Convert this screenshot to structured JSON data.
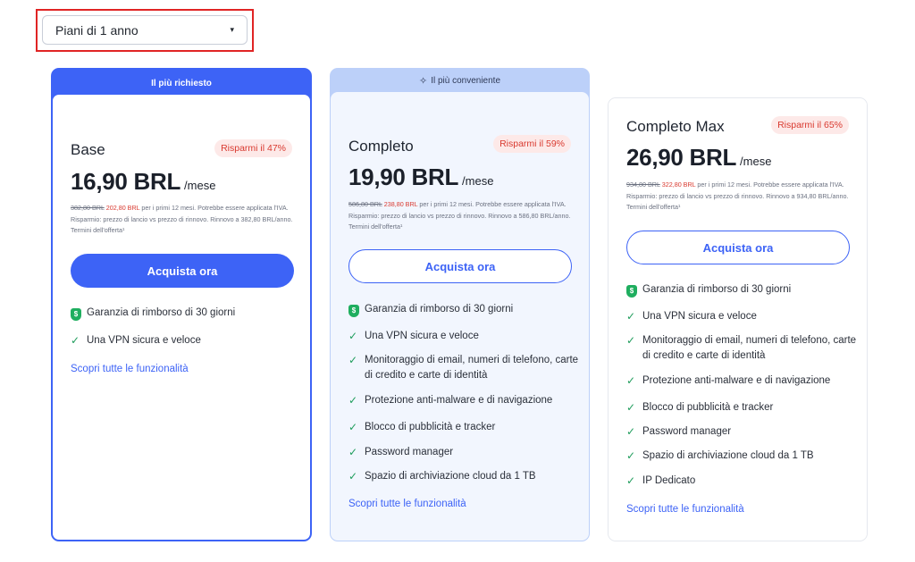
{
  "dropdown": {
    "label": "Piani di 1 anno",
    "caret": "▾"
  },
  "plans": [
    {
      "header": "Il più richiesto",
      "name": "Base",
      "badge": "Risparmi il 47%",
      "price": "16,90 BRL",
      "per": "/mese",
      "old_price": "382,80 BRL",
      "new_price": "202,80 BRL",
      "fine_print": " per i primi 12 mesi. Potrebbe essere applicata l'IVA. Risparmio: prezzo di lancio vs prezzo di rinnovo. Rinnovo a 382,80 BRL/anno. Termini dell'offerta¹",
      "cta": "Acquista ora",
      "guarantee": "Garanzia di rimborso di 30 giorni",
      "features": [
        "Una VPN sicura e veloce"
      ],
      "link": "Scopri tutte le funzionalità"
    },
    {
      "header": "Il più conveniente",
      "name": "Completo",
      "badge": "Risparmi il 59%",
      "price": "19,90 BRL",
      "per": "/mese",
      "old_price": "586,80 BRL",
      "new_price": "238,80 BRL",
      "fine_print": " per i primi 12 mesi. Potrebbe essere applicata l'IVA. Risparmio: prezzo di lancio vs prezzo di rinnovo. Rinnovo a 586,80 BRL/anno. Termini dell'offerta¹",
      "cta": "Acquista ora",
      "guarantee": "Garanzia di rimborso di 30 giorni",
      "features": [
        "Una VPN sicura e veloce",
        "Monitoraggio di email, numeri di telefono, carte di credito e carte di identità",
        "Protezione anti-malware e di navigazione",
        "Blocco di pubblicità e tracker",
        "Password manager",
        "Spazio di archiviazione cloud da 1 TB"
      ],
      "link": "Scopri tutte le funzionalità"
    },
    {
      "name": "Completo Max",
      "badge": "Risparmi il 65%",
      "price": "26,90 BRL",
      "per": "/mese",
      "old_price": "934,80 BRL",
      "new_price": "322,80 BRL",
      "fine_print": " per i primi 12 mesi. Potrebbe essere applicata l'IVA. Risparmio: prezzo di lancio vs prezzo di rinnovo. Rinnovo a 934,80 BRL/anno. Termini dell'offerta¹",
      "cta": "Acquista ora",
      "guarantee": "Garanzia di rimborso di 30 giorni",
      "features": [
        "Una VPN sicura e veloce",
        "Monitoraggio di email, numeri di telefono, carte di credito e carte di identità",
        "Protezione anti-malware e di navigazione",
        "Blocco di pubblicità e tracker",
        "Password manager",
        "Spazio di archiviazione cloud da 1 TB",
        "IP Dedicato"
      ],
      "link": "Scopri tutte le funzionalità"
    }
  ],
  "icons": {
    "check": "check-icon",
    "shield": "shield-icon",
    "sparkle": "sparkle-icon"
  },
  "colors": {
    "accent": "#3d63f6",
    "highlight_outline": "#e02424",
    "discount": "#d93a30",
    "success": "#1fae5f"
  }
}
